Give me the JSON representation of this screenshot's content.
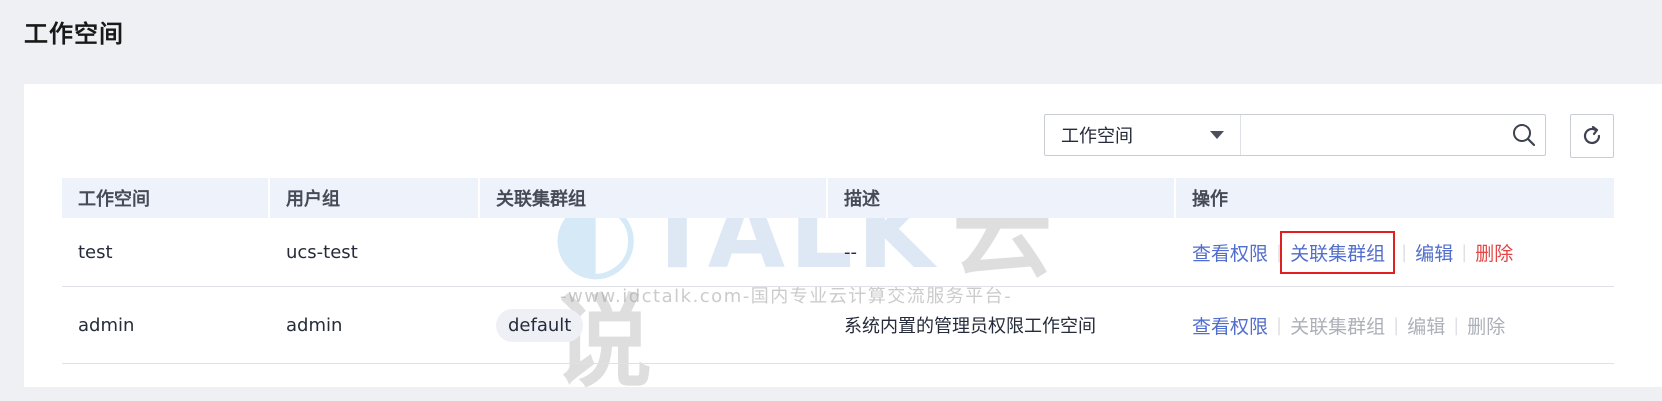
{
  "page": {
    "title": "工作空间"
  },
  "toolbar": {
    "search_filter_value": "工作空间",
    "search_placeholder": ""
  },
  "table": {
    "columns": [
      "工作空间",
      "用户组",
      "关联集群组",
      "描述",
      "操作"
    ],
    "rows": [
      {
        "workspace": "test",
        "user_group": "ucs-test",
        "cluster_group": "",
        "description": "--",
        "ops": {
          "view": "查看权限",
          "associate": "关联集群组",
          "edit": "编辑",
          "delete": "删除"
        }
      },
      {
        "workspace": "admin",
        "user_group": "admin",
        "cluster_group": "default",
        "description": "系统内置的管理员权限工作空间",
        "ops": {
          "view": "查看权限",
          "associate": "关联集群组",
          "edit": "编辑",
          "delete": "删除"
        }
      }
    ]
  },
  "watermark": {
    "logo_latin": "TALK",
    "logo_cn": "云说",
    "url_text": "-www.idctalk.com-国内专业云计算交流服务平台-"
  },
  "colors": {
    "background": "#eff0f4",
    "link": "#526ecc",
    "danger": "#e54545",
    "disabled": "#adb0b8",
    "highlight_box": "#e02020",
    "header_bg": "#eef2fb"
  },
  "icons": {
    "search": "search-icon",
    "refresh": "refresh-icon",
    "dropdown": "caret-down-icon"
  }
}
